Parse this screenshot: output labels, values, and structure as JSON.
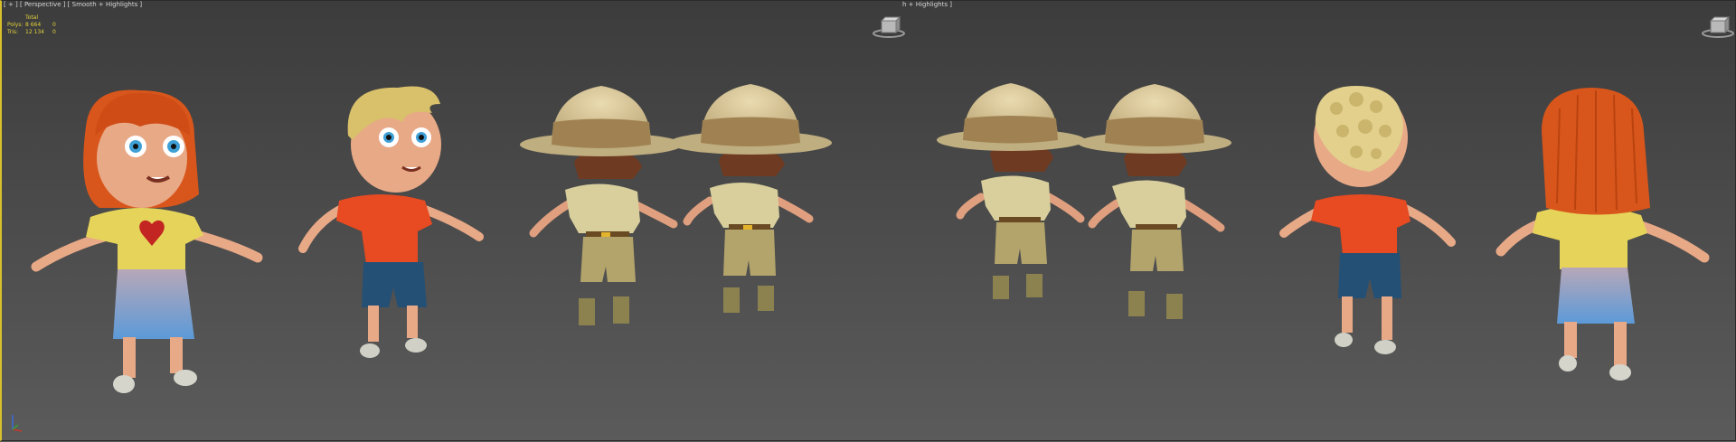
{
  "viewport": {
    "left_label": "[ + ] [ Perspective ] [ Smooth + Highlights ]",
    "right_label": "h + Highlights ]"
  },
  "stats": {
    "header": "Total",
    "rows": [
      {
        "label": "Polys:",
        "value": "8 664",
        "extra": "0"
      },
      {
        "label": "Tris:",
        "value": "12 134",
        "extra": "0"
      }
    ]
  },
  "icons": {
    "viewcube": "viewcube-icon",
    "axis": "axis-tripod-icon"
  },
  "colors": {
    "stats_text": "#e4d23a",
    "selection_border": "#d8c02a",
    "background_top": "#3c3c3c",
    "background_bottom": "#5b5b5b"
  },
  "characters": [
    {
      "id": "girl-front",
      "view": "front"
    },
    {
      "id": "boy-front",
      "view": "front"
    },
    {
      "id": "ranger-front-left",
      "view": "front"
    },
    {
      "id": "ranger-front-right",
      "view": "front"
    },
    {
      "id": "ranger-back-left",
      "view": "back"
    },
    {
      "id": "ranger-back-right",
      "view": "back"
    },
    {
      "id": "boy-back",
      "view": "back"
    },
    {
      "id": "girl-back",
      "view": "back"
    }
  ]
}
